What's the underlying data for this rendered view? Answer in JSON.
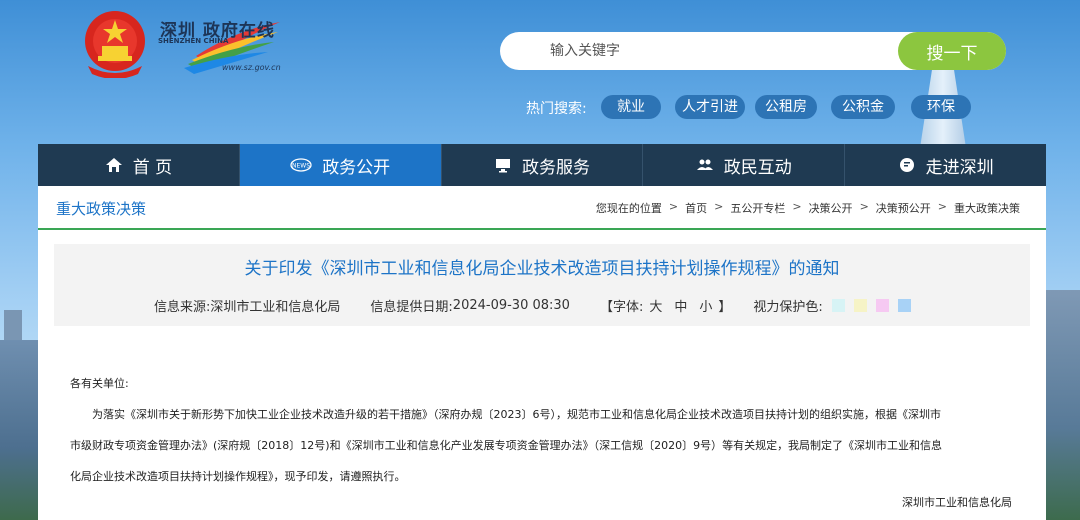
{
  "header": {
    "logo_cn": "深圳 政府在线",
    "logo_en": "SHENZHEN CHINA",
    "logo_url": "www.sz.gov.cn"
  },
  "search": {
    "placeholder": "输入关键字",
    "button_label": "搜一下"
  },
  "hot_search": {
    "label": "热门搜索:",
    "tags": [
      "就业",
      "人才引进",
      "公租房",
      "公积金",
      "环保"
    ]
  },
  "nav": {
    "items": [
      {
        "label": "首 页",
        "icon": "home-icon"
      },
      {
        "label": "政务公开",
        "icon": "news-icon"
      },
      {
        "label": "政务服务",
        "icon": "monitor-icon"
      },
      {
        "label": "政民互动",
        "icon": "people-icon"
      },
      {
        "label": "走进深圳",
        "icon": "chat-icon"
      }
    ],
    "active_index": 1
  },
  "section": {
    "title": "重大政策决策"
  },
  "breadcrumb": {
    "prefix": "您现在的位置",
    "items": [
      "首页",
      "五公开专栏",
      "决策公开",
      "决策预公开",
      "重大政策决策"
    ],
    "separator": ">"
  },
  "article": {
    "title": "关于印发《深圳市工业和信息化局企业技术改造项目扶持计划操作规程》的通知",
    "source_label": "信息来源:",
    "source_value": "深圳市工业和信息化局",
    "date_label": "信息提供日期:",
    "date_value": "2024-09-30 08:30",
    "font_label_open": "【字体:",
    "font_sizes": [
      "大",
      "中",
      "小"
    ],
    "font_label_close": "】",
    "eye_label": "视力保护色:",
    "eye_colors": [
      "#d7f3f5",
      "#f6f3c6",
      "#f6c9f2",
      "#a8d2f6"
    ],
    "salutation": "各有关单位:",
    "paragraph_line1": "为落实《深圳市关于新形势下加快工业企业技术改造升级的若干措施》（深府办规〔2023〕6号），规范市工业和信息化局企业技术改造项目扶持计划的组织实施，根据《深圳市",
    "paragraph_line2": "市级财政专项资金管理办法》(深府规〔2018〕12号)和《深圳市工业和信息化产业发展专项资金管理办法》（深工信规〔2020〕9号）等有关规定，我局制定了《深圳市工业和信息",
    "paragraph_line3": "化局企业技术改造项目扶持计划操作规程》，现予印发，请遵照执行。",
    "signature": "深圳市工业和信息化局"
  },
  "colors": {
    "nav_bg": "#1f3a52",
    "nav_active": "#1d74c7",
    "search_button": "#8cc63f",
    "hot_tag": "#2d74b5",
    "title_blue": "#1d74c7",
    "divider_green": "#3aa655"
  }
}
